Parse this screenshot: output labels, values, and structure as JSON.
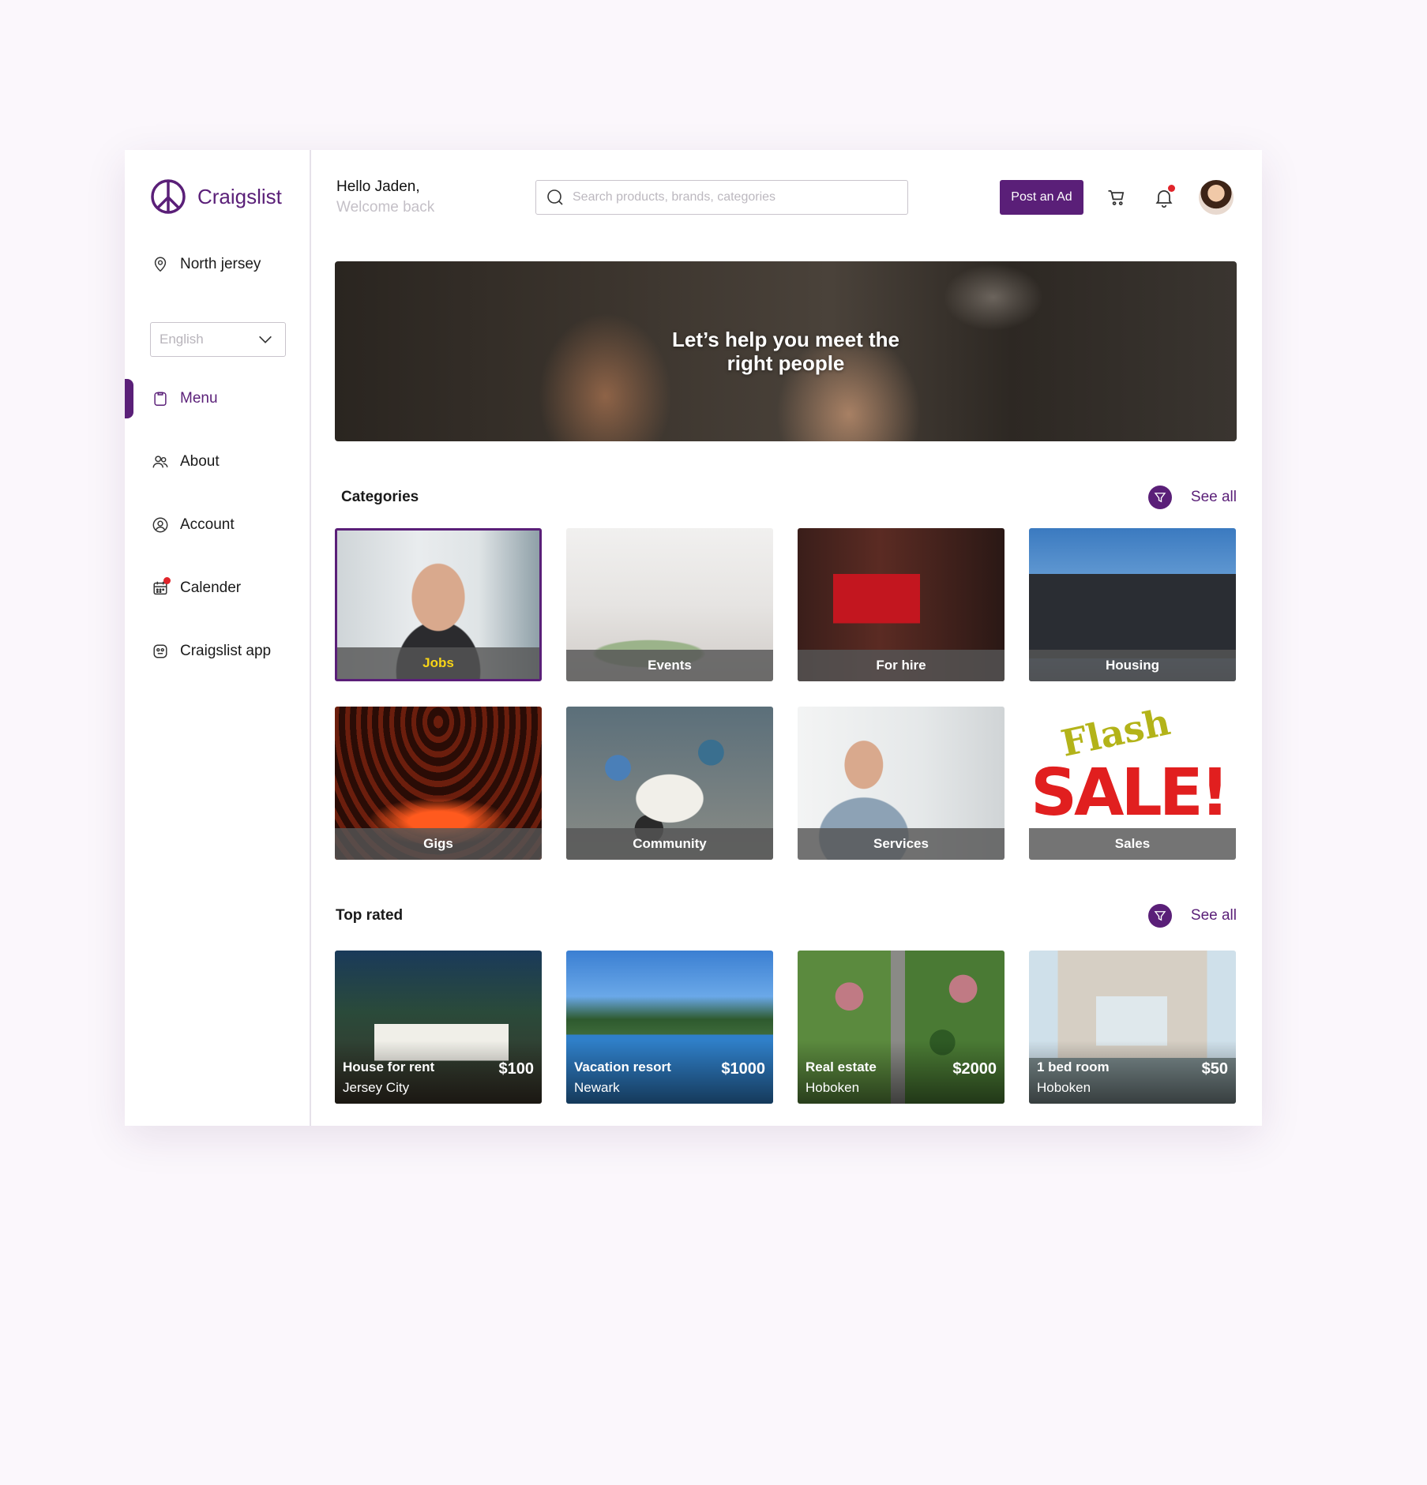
{
  "brand": {
    "name": "Craigslist",
    "color": "#5a1f78"
  },
  "sidebar": {
    "location": "North jersey",
    "language": {
      "selected": "English"
    },
    "items": [
      {
        "label": "Menu",
        "icon": "clipboard-icon",
        "active": true
      },
      {
        "label": "About",
        "icon": "users-icon",
        "active": false
      },
      {
        "label": "Account",
        "icon": "user-circle-icon",
        "active": false
      },
      {
        "label": "Calender",
        "icon": "calendar-icon",
        "active": false
      },
      {
        "label": "Craigslist app",
        "icon": "app-icon",
        "active": false
      }
    ]
  },
  "header": {
    "hello": "Hello Jaden,",
    "welcome": "Welcome back",
    "search_placeholder": "Search products, brands, categories",
    "post_button": "Post an Ad"
  },
  "hero": {
    "title": "Let’s help you meet the right people"
  },
  "categories": {
    "title": "Categories",
    "see_all": "See all",
    "items": [
      {
        "label": "Jobs",
        "selected": true
      },
      {
        "label": "Events"
      },
      {
        "label": "For hire"
      },
      {
        "label": "Housing"
      },
      {
        "label": "Gigs"
      },
      {
        "label": "Community"
      },
      {
        "label": "Services"
      },
      {
        "label": "Sales"
      }
    ],
    "sales_image_text": {
      "flash": "Flash",
      "sale": "SALE!"
    }
  },
  "top_rated": {
    "title": "Top rated",
    "see_all": "See all",
    "items": [
      {
        "title": "House for rent",
        "location": "Jersey City",
        "price": "$100"
      },
      {
        "title": "Vacation resort",
        "location": "Newark",
        "price": "$1000"
      },
      {
        "title": "Real estate",
        "location": "Hoboken",
        "price": "$2000"
      },
      {
        "title": "1 bed room",
        "location": "Hoboken",
        "price": "$50"
      }
    ]
  },
  "colors": {
    "accent": "#5a1f78",
    "notification": "#e0242a",
    "selected_label": "#f7d417"
  }
}
